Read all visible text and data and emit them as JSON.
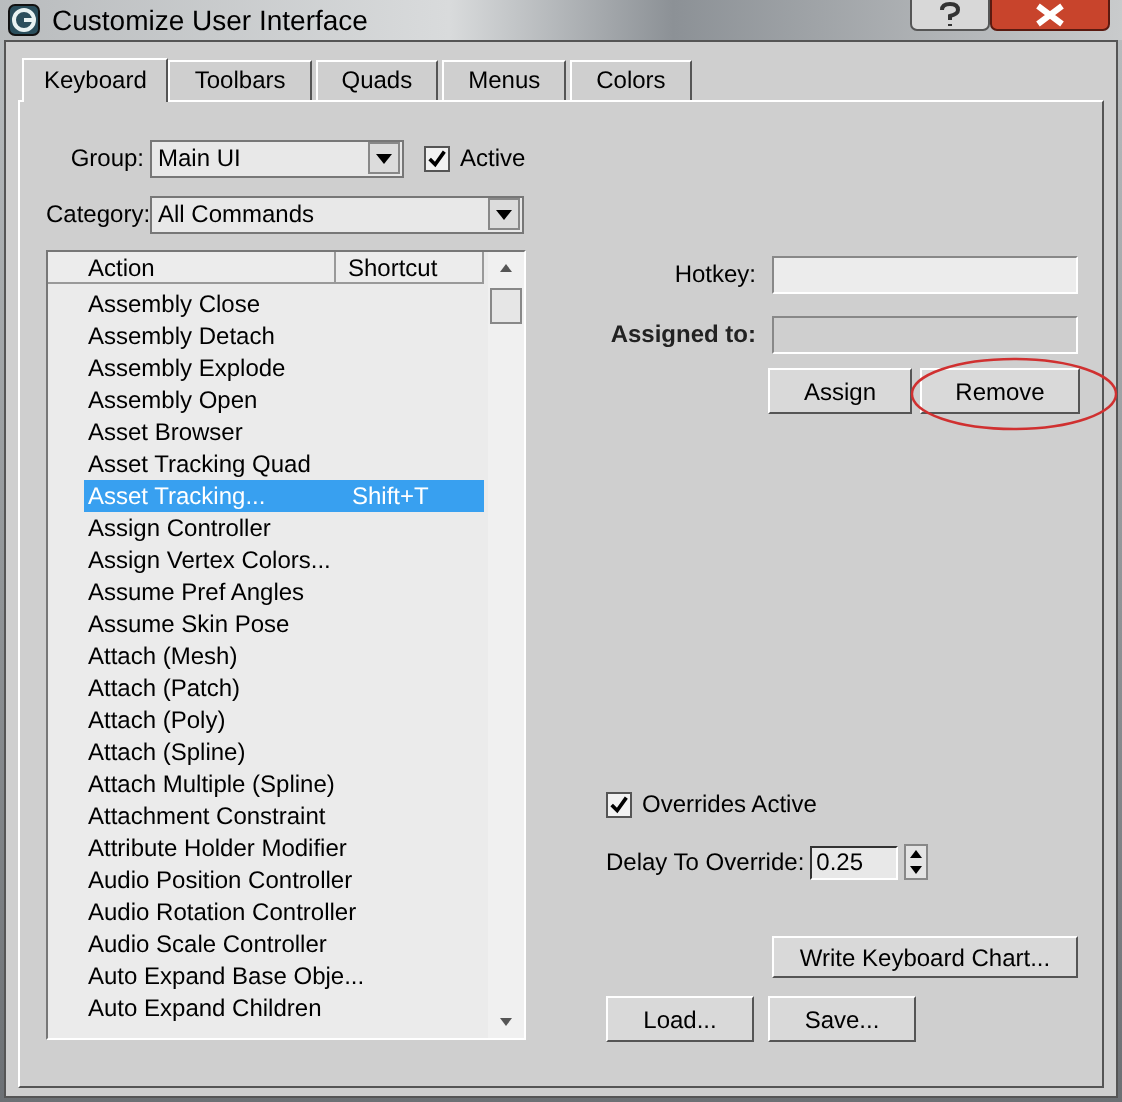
{
  "window": {
    "title": "Customize User Interface"
  },
  "tabs": [
    {
      "label": "Keyboard",
      "selected": true
    },
    {
      "label": "Toolbars",
      "selected": false
    },
    {
      "label": "Quads",
      "selected": false
    },
    {
      "label": "Menus",
      "selected": false
    },
    {
      "label": "Colors",
      "selected": false
    }
  ],
  "group": {
    "label": "Group:",
    "value": "Main UI"
  },
  "active": {
    "label": "Active",
    "checked": true
  },
  "category": {
    "label": "Category:",
    "value": "All Commands"
  },
  "actions": {
    "columns": [
      "Action",
      "Shortcut"
    ],
    "rows": [
      {
        "action": "Assembly Close",
        "selected": false
      },
      {
        "action": "Assembly Detach",
        "selected": false
      },
      {
        "action": "Assembly Explode",
        "selected": false
      },
      {
        "action": "Assembly Open",
        "selected": false
      },
      {
        "action": "Asset Browser",
        "selected": false
      },
      {
        "action": "Asset Tracking Quad",
        "selected": false
      },
      {
        "action": "Asset Tracking...",
        "shortcut": "Shift+T",
        "selected": true
      },
      {
        "action": "Assign Controller",
        "selected": false
      },
      {
        "action": "Assign Vertex Colors...",
        "selected": false
      },
      {
        "action": "Assume Pref Angles",
        "selected": false
      },
      {
        "action": "Assume Skin Pose",
        "selected": false
      },
      {
        "action": "Attach (Mesh)",
        "selected": false
      },
      {
        "action": "Attach (Patch)",
        "selected": false
      },
      {
        "action": "Attach (Poly)",
        "selected": false
      },
      {
        "action": "Attach (Spline)",
        "selected": false
      },
      {
        "action": "Attach Multiple (Spline)",
        "selected": false
      },
      {
        "action": "Attachment Constraint",
        "selected": false
      },
      {
        "action": "Attribute Holder Modifier",
        "selected": false
      },
      {
        "action": "Audio Position Controller",
        "selected": false
      },
      {
        "action": "Audio Rotation Controller",
        "selected": false
      },
      {
        "action": "Audio Scale Controller",
        "selected": false
      },
      {
        "action": "Auto Expand Base Obje...",
        "selected": false
      },
      {
        "action": "Auto Expand Children",
        "selected": false
      }
    ]
  },
  "hotkey": {
    "label": "Hotkey:"
  },
  "assigned_to": {
    "label": "Assigned to:"
  },
  "assign_buttons": [
    "Assign",
    "Remove"
  ],
  "overrides": {
    "label": "Overrides Active",
    "checked": true
  },
  "delay": {
    "label": "Delay To Override:",
    "value": "0.25"
  },
  "chart_button": "Write Keyboard Chart...",
  "file_buttons": [
    "Load...",
    "Save..."
  ]
}
